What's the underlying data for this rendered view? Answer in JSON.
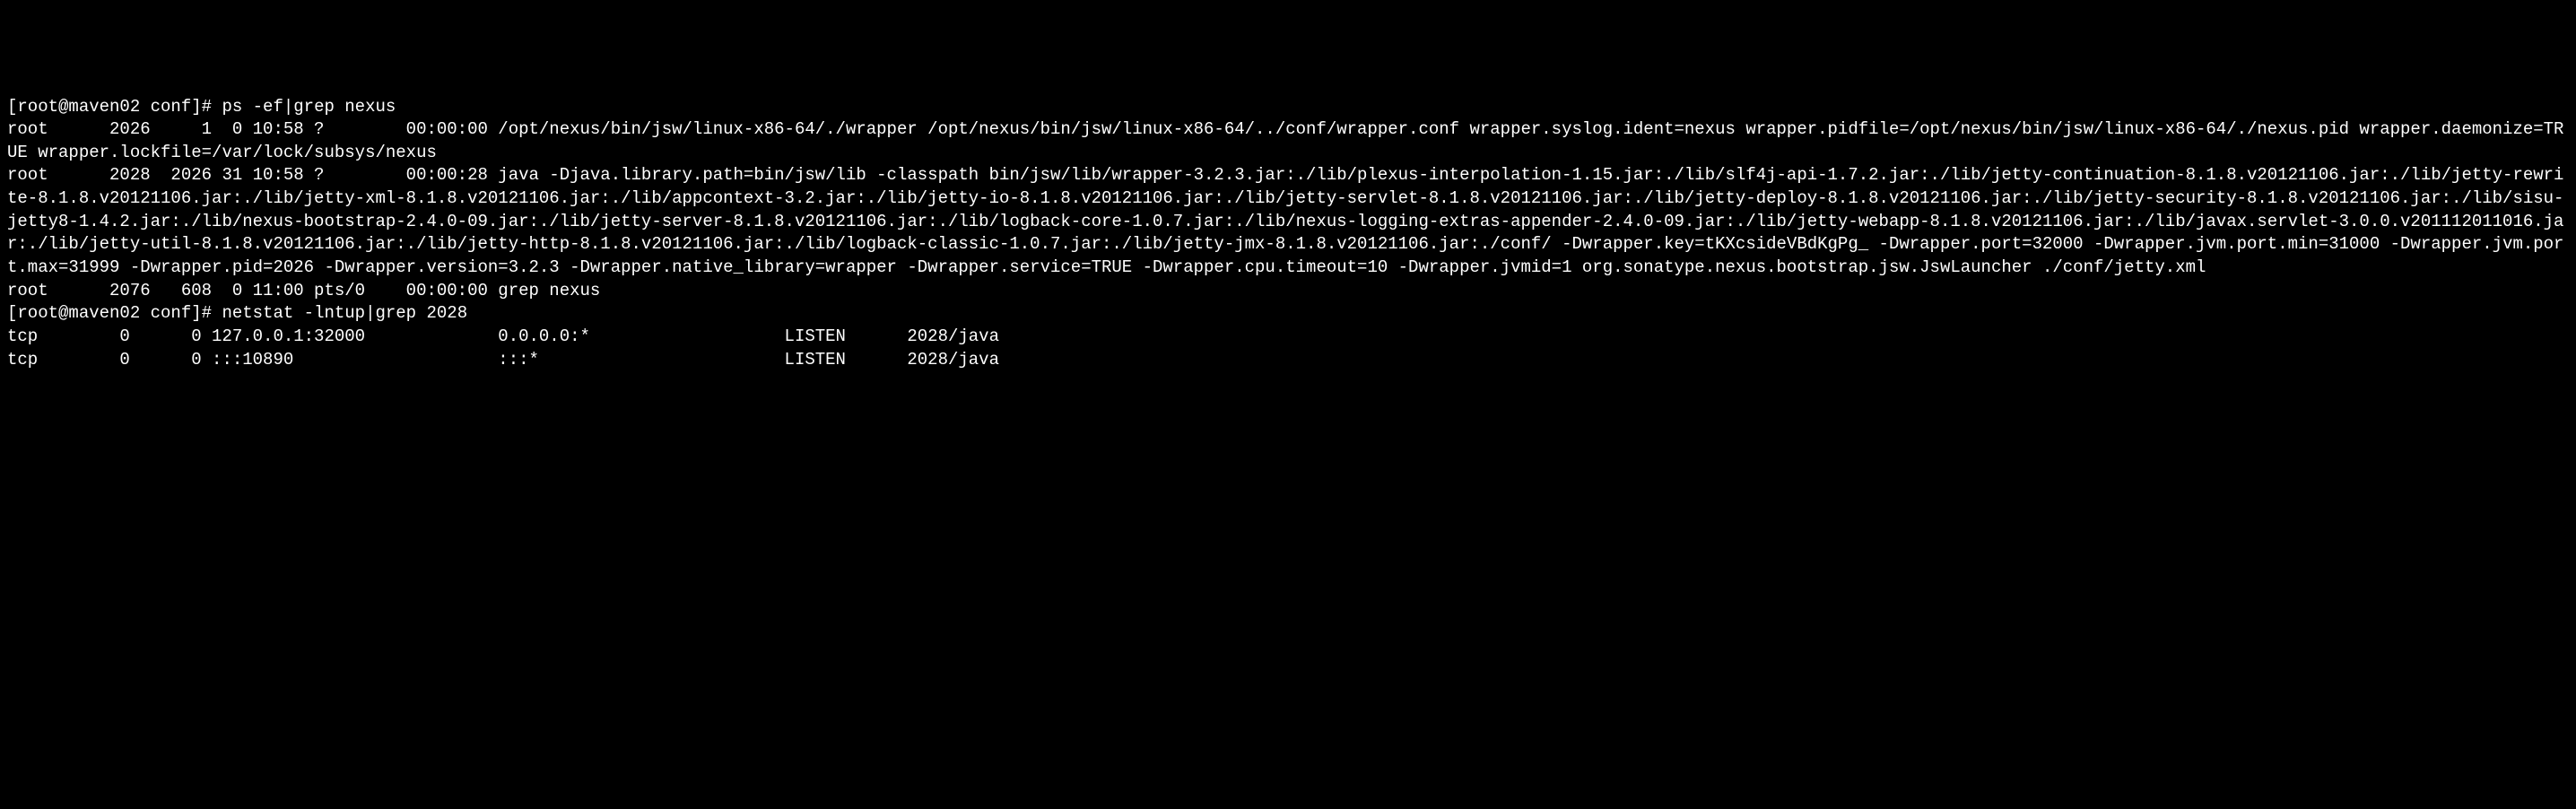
{
  "terminal": {
    "prompt1": "[root@maven02 conf]# ",
    "command1": "ps -ef|grep nexus",
    "process1": "root      2026     1  0 10:58 ?        00:00:00 /opt/nexus/bin/jsw/linux-x86-64/./wrapper /opt/nexus/bin/jsw/linux-x86-64/../conf/wrapper.conf wrapper.syslog.ident=nexus wrapper.pidfile=/opt/nexus/bin/jsw/linux-x86-64/./nexus.pid wrapper.daemonize=TRUE wrapper.lockfile=/var/lock/subsys/nexus",
    "process2": "root      2028  2026 31 10:58 ?        00:00:28 java -Djava.library.path=bin/jsw/lib -classpath bin/jsw/lib/wrapper-3.2.3.jar:./lib/plexus-interpolation-1.15.jar:./lib/slf4j-api-1.7.2.jar:./lib/jetty-continuation-8.1.8.v20121106.jar:./lib/jetty-rewrite-8.1.8.v20121106.jar:./lib/jetty-xml-8.1.8.v20121106.jar:./lib/appcontext-3.2.jar:./lib/jetty-io-8.1.8.v20121106.jar:./lib/jetty-servlet-8.1.8.v20121106.jar:./lib/jetty-deploy-8.1.8.v20121106.jar:./lib/jetty-security-8.1.8.v20121106.jar:./lib/sisu-jetty8-1.4.2.jar:./lib/nexus-bootstrap-2.4.0-09.jar:./lib/jetty-server-8.1.8.v20121106.jar:./lib/logback-core-1.0.7.jar:./lib/nexus-logging-extras-appender-2.4.0-09.jar:./lib/jetty-webapp-8.1.8.v20121106.jar:./lib/javax.servlet-3.0.0.v201112011016.jar:./lib/jetty-util-8.1.8.v20121106.jar:./lib/jetty-http-8.1.8.v20121106.jar:./lib/logback-classic-1.0.7.jar:./lib/jetty-jmx-8.1.8.v20121106.jar:./conf/ -Dwrapper.key=tKXcsideVBdKgPg_ -Dwrapper.port=32000 -Dwrapper.jvm.port.min=31000 -Dwrapper.jvm.port.max=31999 -Dwrapper.pid=2026 -Dwrapper.version=3.2.3 -Dwrapper.native_library=wrapper -Dwrapper.service=TRUE -Dwrapper.cpu.timeout=10 -Dwrapper.jvmid=1 org.sonatype.nexus.bootstrap.jsw.JswLauncher ./conf/jetty.xml",
    "process3": "root      2076   608  0 11:00 pts/0    00:00:00 grep nexus",
    "prompt2": "[root@maven02 conf]# ",
    "command2": "netstat -lntup|grep 2028",
    "netstat1": "tcp        0      0 127.0.0.1:32000             0.0.0.0:*                   LISTEN      2028/java",
    "netstat2": "tcp        0      0 :::10890                    :::*                        LISTEN      2028/java"
  }
}
